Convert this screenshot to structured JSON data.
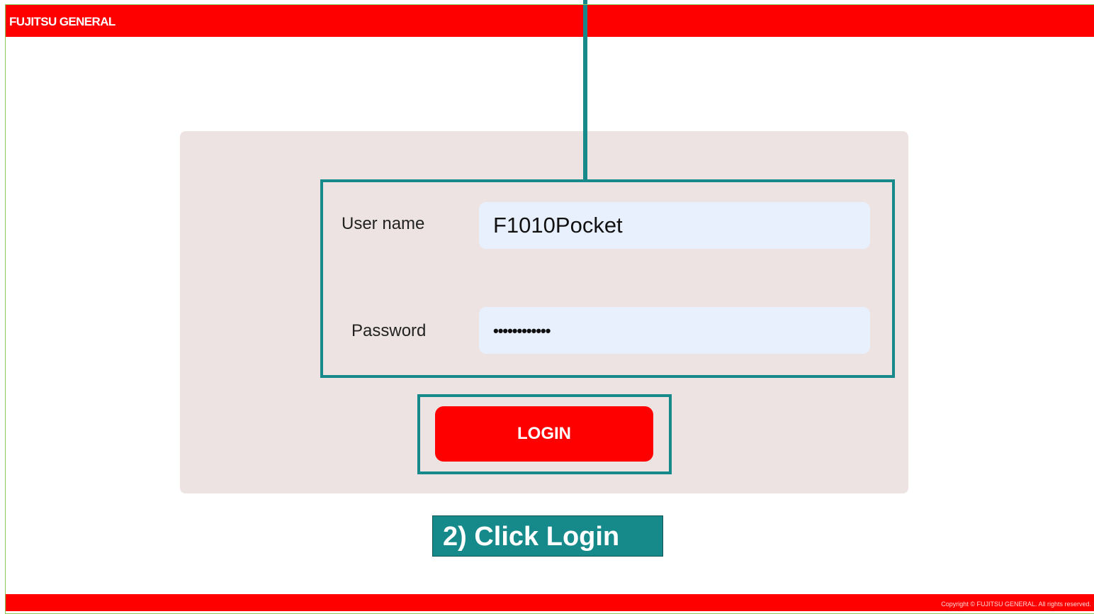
{
  "header": {
    "brand": "FUJITSU GENERAL"
  },
  "login_form": {
    "username_label": "User name",
    "username_value": "F1010Pocket",
    "password_label": "Password",
    "password_value": "••••••••••••",
    "login_button": "LOGIN"
  },
  "annotation": {
    "callout_text": "2) Click Login"
  },
  "footer": {
    "copyright": "Copyright © FUJITSU GENERAL. All rights reserved."
  },
  "colors": {
    "brand_red": "#ff0000",
    "annotation_teal": "#168a8a",
    "panel_bg": "#ede3e2",
    "input_bg": "#e8f0fe"
  }
}
